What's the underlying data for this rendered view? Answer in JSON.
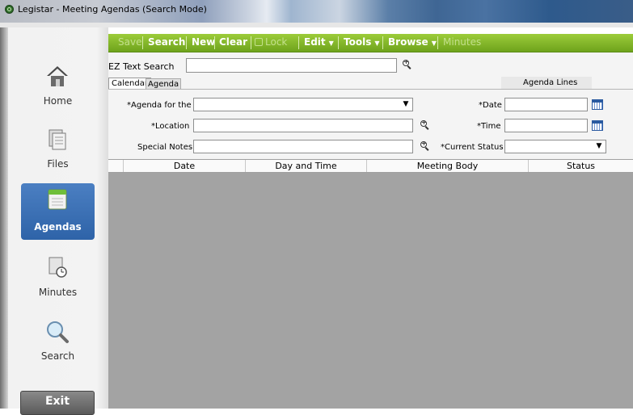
{
  "window": {
    "title": "Legistar - Meeting Agendas (Search Mode)"
  },
  "nav": {
    "items": [
      {
        "label": "Home",
        "icon": "home-icon"
      },
      {
        "label": "Files",
        "icon": "files-icon"
      },
      {
        "label": "Agendas",
        "icon": "agendas-icon"
      },
      {
        "label": "Minutes",
        "icon": "minutes-icon"
      },
      {
        "label": "Search",
        "icon": "search-icon"
      }
    ],
    "exit_label": "Exit",
    "active": "Agendas"
  },
  "toolbar": {
    "save": "Save",
    "search": "Search",
    "new": "New",
    "clear": "Clear",
    "lock": "Lock",
    "edit": "Edit",
    "tools": "Tools",
    "browse": "Browse",
    "minutes": "Minutes"
  },
  "search": {
    "ez_label": "EZ Text Search",
    "ez_value": ""
  },
  "tabs": {
    "calendar": "Calendar",
    "agenda": "Agenda",
    "agenda_lines": "Agenda Lines"
  },
  "form": {
    "agenda_for_label": "*Agenda for the",
    "location_label": "*Location",
    "special_notes_label": "Special Notes",
    "date_label": "*Date",
    "time_label": "*Time",
    "current_status_label": "*Current Status",
    "agenda_for_value": "",
    "location_value": "",
    "special_notes_value": "",
    "date_value": "",
    "time_value": "",
    "current_status_value": ""
  },
  "grid": {
    "columns": [
      "Date",
      "Day and Time",
      "Meeting Body",
      "Status"
    ],
    "rows": []
  },
  "colors": {
    "toolbar": "#7fb52a",
    "active_nav": "#3a6fb4",
    "grid_bg": "#a3a3a3"
  }
}
